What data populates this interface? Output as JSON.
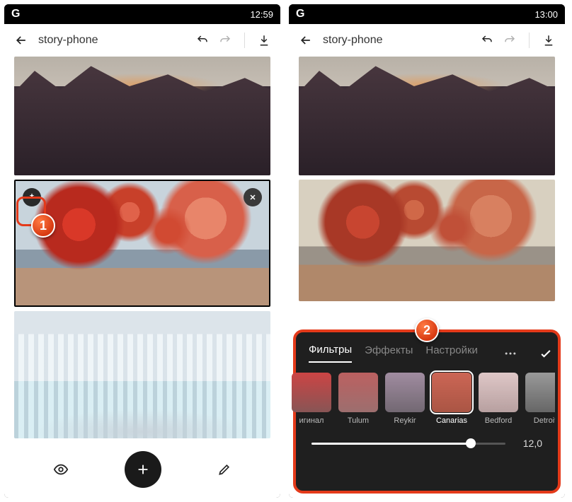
{
  "left": {
    "status_time": "12:59",
    "title": "story-phone",
    "callout": "1"
  },
  "right": {
    "status_time": "13:00",
    "title": "story-phone",
    "callout": "2",
    "tabs": {
      "filters": "Фильтры",
      "effects": "Эффекты",
      "settings": "Настройки"
    },
    "filters": [
      {
        "key": "original",
        "label": "игинал"
      },
      {
        "key": "tulum",
        "label": "Tulum"
      },
      {
        "key": "reykir",
        "label": "Reykir"
      },
      {
        "key": "canarias",
        "label": "Canarias",
        "selected": true
      },
      {
        "key": "bedford",
        "label": "Bedford"
      },
      {
        "key": "detroit",
        "label": "Detroit"
      }
    ],
    "slider_value": "12,0"
  }
}
